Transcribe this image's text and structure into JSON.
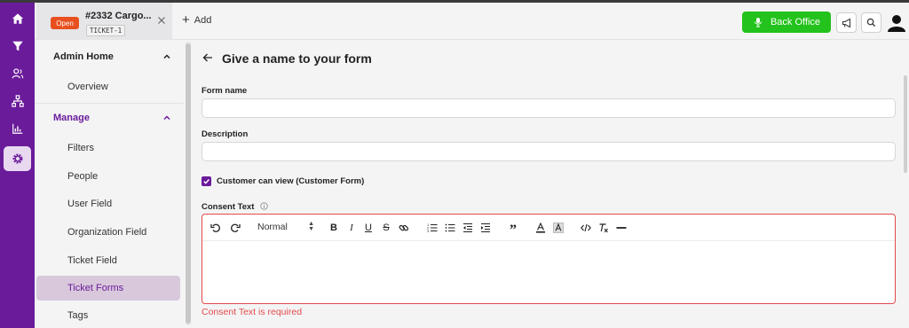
{
  "tab": {
    "status": "Open",
    "title": "#2332 Cargo...",
    "code": "TICKET-1",
    "add_label": "Add"
  },
  "header": {
    "back_office_label": "Back Office"
  },
  "sidebar": {
    "sections": [
      {
        "label": "Admin Home",
        "items": [
          "Overview"
        ]
      },
      {
        "label": "Manage",
        "items": [
          "Filters",
          "People",
          "User Field",
          "Organization Field",
          "Ticket Field",
          "Ticket Forms",
          "Tags"
        ]
      }
    ],
    "active_item": "Ticket Forms"
  },
  "main": {
    "title": "Give a name to your form",
    "form_name_label": "Form name",
    "form_name_value": "",
    "description_label": "Description",
    "description_value": "",
    "customer_view_label": "Customer can view (Customer Form)",
    "customer_view_checked": true,
    "consent_label": "Consent Text",
    "format_value": "Normal",
    "consent_error": "Consent Text is required"
  },
  "colors": {
    "brand": "#6a1b9a",
    "success": "#23c21c",
    "error": "#e34a4a",
    "badge": "#e8501f"
  },
  "icons": {
    "rail": [
      "home-icon",
      "filter-icon",
      "people-icon",
      "hierarchy-icon",
      "chart-icon",
      "settings-icon"
    ],
    "toolbar": [
      "undo-icon",
      "redo-icon",
      "bold-icon",
      "italic-icon",
      "underline-icon",
      "strikethrough-icon",
      "link-icon",
      "ordered-list-icon",
      "bullet-list-icon",
      "outdent-icon",
      "indent-icon",
      "quote-icon",
      "font-color-icon",
      "highlight-icon",
      "code-icon",
      "clear-format-icon",
      "horizontal-rule-icon"
    ]
  }
}
